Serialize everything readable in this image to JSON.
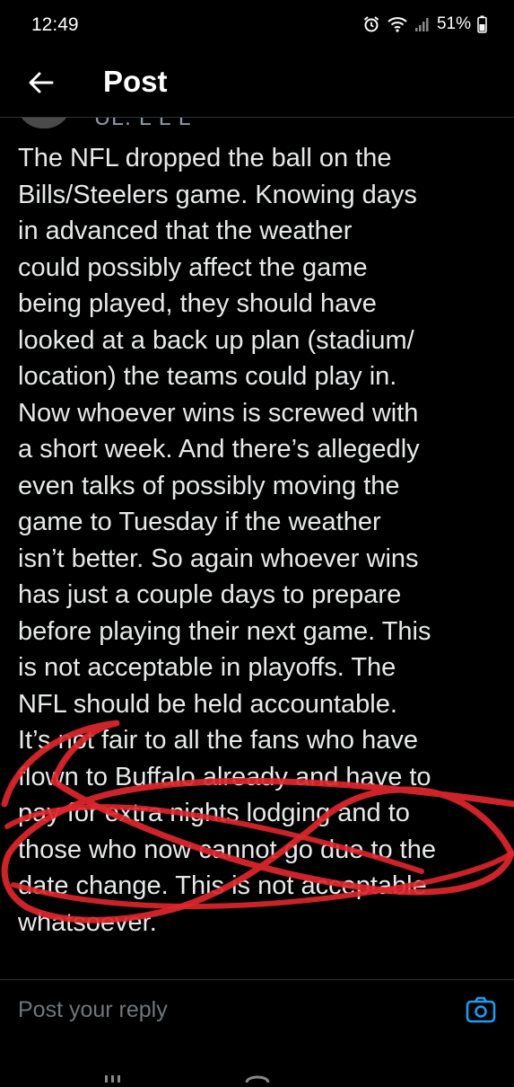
{
  "status_bar": {
    "time": "12:49",
    "battery": "51%",
    "icons": [
      "alarm-icon",
      "wifi-icon",
      "signal-icon",
      "battery-icon"
    ]
  },
  "header": {
    "title": "Post",
    "back_icon": "arrow-left-icon"
  },
  "post": {
    "username_partial": "UL. L   L     L",
    "text": "The NFL dropped the ball on the\nBills/Steelers game. Knowing days\nin advanced that the weather\ncould possibly affect the game\nbeing played, they should have\nlooked at a back up plan (stadium/\nlocation) the teams could play in.\nNow whoever wins is screwed with\na short week. And there’s allegedly\neven talks of possibly moving the\ngame to Tuesday if the weather\nisn’t better. So again whoever wins\nhas just a couple days to prepare\nbefore playing their next game. This\nis not acceptable in playoffs. The\nNFL should be held accountable.\nIt’s not fair to all the fans who have\nflown to Buffalo already and have to\npay for extra nights lodging and to\nthose who now cannot go due to the\ndate change. This is not acceptable\nwhatsoever."
  },
  "reply": {
    "placeholder": "Post your reply",
    "camera_icon": "camera-icon"
  },
  "colors": {
    "background": "#000000",
    "text": "#e7e9ea",
    "muted": "#71767b",
    "accent": "#1d9bf0",
    "scribble": "#e0262b"
  }
}
